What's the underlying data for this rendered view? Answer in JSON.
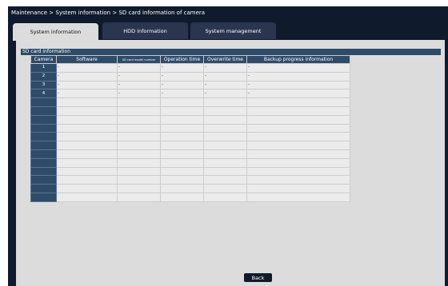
{
  "breadcrumb": "Maintenance > System information > SD card information of camera",
  "tabs": [
    {
      "label": "System information",
      "active": true
    },
    {
      "label": "HDD information",
      "active": false
    },
    {
      "label": "System management",
      "active": false
    }
  ],
  "section_title": "SD card information",
  "table": {
    "headers": [
      "Camera",
      "Software",
      "SD card model number",
      "Operation time",
      "Overwrite time",
      "Backup progress information"
    ],
    "rows": [
      {
        "camera": "1",
        "cells": [
          "-",
          "-",
          "-",
          "-",
          "-"
        ]
      },
      {
        "camera": "2",
        "cells": [
          "-",
          "-",
          "-",
          "-",
          "-"
        ]
      },
      {
        "camera": "3",
        "cells": [
          "-",
          "-",
          "-",
          "-",
          "-"
        ]
      },
      {
        "camera": "4",
        "cells": [
          "-",
          "-",
          "-",
          "-",
          "-"
        ]
      },
      {
        "camera": "",
        "cells": [
          "",
          "",
          "",
          "",
          ""
        ]
      },
      {
        "camera": "",
        "cells": [
          "",
          "",
          "",
          "",
          ""
        ]
      },
      {
        "camera": "",
        "cells": [
          "",
          "",
          "",
          "",
          ""
        ]
      },
      {
        "camera": "",
        "cells": [
          "",
          "",
          "",
          "",
          ""
        ]
      },
      {
        "camera": "",
        "cells": [
          "",
          "",
          "",
          "",
          ""
        ]
      },
      {
        "camera": "",
        "cells": [
          "",
          "",
          "",
          "",
          ""
        ]
      },
      {
        "camera": "",
        "cells": [
          "",
          "",
          "",
          "",
          ""
        ]
      },
      {
        "camera": "",
        "cells": [
          "",
          "",
          "",
          "",
          ""
        ]
      },
      {
        "camera": "",
        "cells": [
          "",
          "",
          "",
          "",
          ""
        ]
      },
      {
        "camera": "",
        "cells": [
          "",
          "",
          "",
          "",
          ""
        ]
      },
      {
        "camera": "",
        "cells": [
          "",
          "",
          "",
          "",
          ""
        ]
      },
      {
        "camera": "",
        "cells": [
          "",
          "",
          "",
          "",
          ""
        ]
      }
    ]
  },
  "back_label": "Back"
}
